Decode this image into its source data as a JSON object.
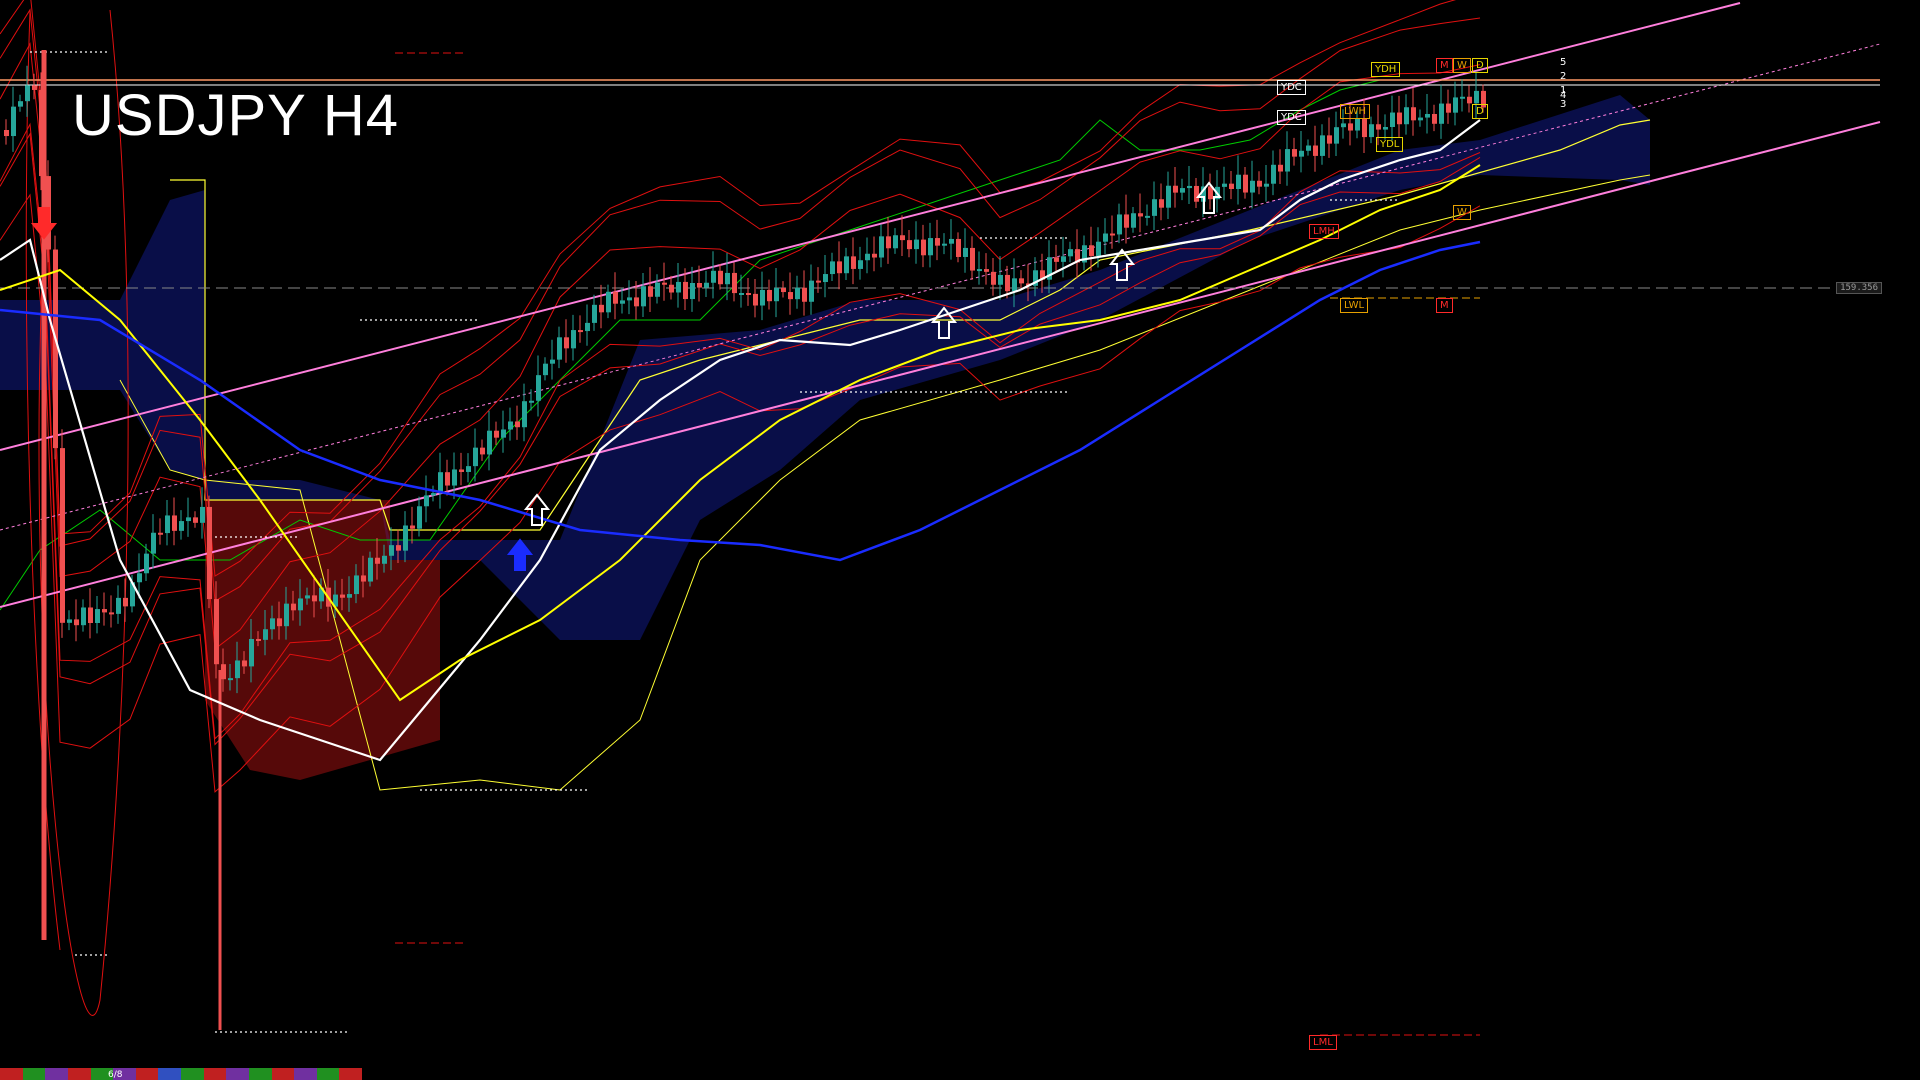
{
  "header": {
    "title": "USDJPY H4"
  },
  "price_axis": {
    "current_price": "159.356"
  },
  "level_labels": [
    {
      "text": "YDH",
      "color": "#e6d600"
    },
    {
      "text": "YDC",
      "color": "#ffffff"
    },
    {
      "text": "YDC",
      "color": "#ffffff"
    },
    {
      "text": "LWH",
      "color": "#e6a000"
    },
    {
      "text": "YDL",
      "color": "#e6d600"
    },
    {
      "text": "LMH",
      "color": "#ff2a2a"
    },
    {
      "text": "LWL",
      "color": "#e6a000"
    },
    {
      "text": "M",
      "color": "#ff2a2a"
    },
    {
      "text": "W",
      "color": "#e6a000"
    },
    {
      "text": "D",
      "color": "#e6d600"
    },
    {
      "text": "D",
      "color": "#e6d600"
    },
    {
      "text": "W",
      "color": "#e6a000"
    },
    {
      "text": "M",
      "color": "#ff2a2a"
    },
    {
      "text": "LML",
      "color": "#ff2a2a"
    }
  ],
  "ma_labels": [
    "5",
    "2",
    "1",
    "4",
    "3"
  ],
  "status_strip": {
    "text": "6/8"
  },
  "colors": {
    "background": "#000000",
    "bull_candle": "#26a69a",
    "bear_candle": "#f05050",
    "ma_white": "#ffffff",
    "ma_yellow": "#ffff00",
    "ma_blue": "#1a2cff",
    "channel": "#ff7fdc",
    "bollinger": "#e01010",
    "cloud_upper": "#ffff33",
    "cloud_lower": "#00cc00"
  },
  "chart_data": {
    "type": "candlestick",
    "title": "USDJPY H4",
    "ylabel": "",
    "ylim": [
      141.5,
      162.0
    ],
    "current_price": 159.356,
    "candles": [],
    "series": [
      {
        "values": []
      }
    ]
  }
}
